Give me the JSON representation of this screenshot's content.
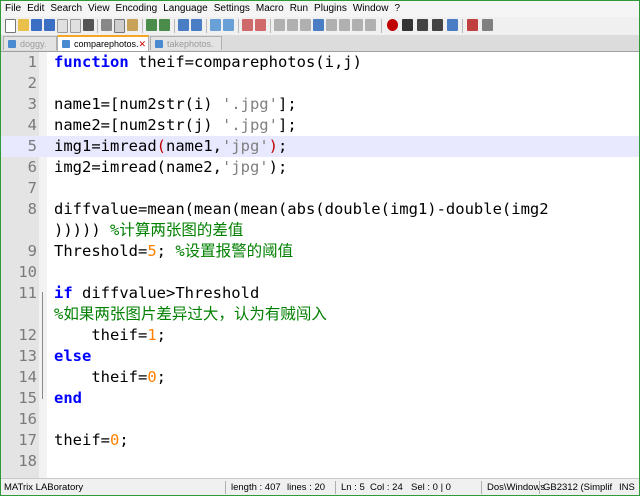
{
  "menu": [
    "File",
    "Edit",
    "Search",
    "View",
    "Encoding",
    "Language",
    "Settings",
    "Macro",
    "Run",
    "Plugins",
    "Window",
    "?"
  ],
  "tabs": [
    {
      "label": "doggy.",
      "active": false
    },
    {
      "label": "comparephotos.",
      "active": true
    },
    {
      "label": "takephotos.",
      "active": false
    }
  ],
  "editor": {
    "lines": [
      {
        "num": "1",
        "html": "<span class=\"kw\">function</span> theif=comparephotos(i,j)"
      },
      {
        "num": "2",
        "html": ""
      },
      {
        "num": "3",
        "html": "name1=[num2str(i) <span class=\"str\">'.jpg'</span>];"
      },
      {
        "num": "4",
        "html": "name2=[num2str(j) <span class=\"str\">'.jpg'</span>];"
      },
      {
        "num": "5",
        "html": "img1=imread<span style=\"color:#c00000\">(</span>name1,<span class=\"str\">'jpg'</span><span style=\"color:#c00000\">)</span>;"
      },
      {
        "num": "6",
        "html": "img2=imread(name2,<span class=\"str\">'jpg'</span>);"
      },
      {
        "num": "7",
        "html": ""
      },
      {
        "num": "8",
        "html": "diffvalue=mean(mean(mean(abs(double(img1)-double(img2"
      },
      {
        "num": "",
        "html": "))))) <span class=\"cmt\">%计算两张图的差值</span>"
      },
      {
        "num": "9",
        "html": "Threshold=<span class=\"num\">5</span>; <span class=\"cmt\">%设置报警的阈值</span>"
      },
      {
        "num": "10",
        "html": ""
      },
      {
        "num": "11",
        "html": "<span class=\"kw\">if</span> diffvalue>Threshold"
      },
      {
        "num": "",
        "html": "<span class=\"cmt\">%如果两张图片差异过大，认为有贼闯入</span>"
      },
      {
        "num": "12",
        "html": "    theif=<span class=\"num\">1</span>;"
      },
      {
        "num": "13",
        "html": "<span class=\"kw\">else</span>"
      },
      {
        "num": "14",
        "html": "    theif=<span class=\"num\">0</span>;"
      },
      {
        "num": "15",
        "html": "<span class=\"kw\">end</span>"
      },
      {
        "num": "16",
        "html": ""
      },
      {
        "num": "17",
        "html": "theif=<span class=\"num\">0</span>;"
      },
      {
        "num": "18",
        "html": ""
      }
    ]
  },
  "status": {
    "language": "MATrix LABoratory",
    "length": "length : 407",
    "lines": "lines : 20",
    "ln": "Ln : 5",
    "col": "Col : 24",
    "sel": "Sel : 0 | 0",
    "eol": "Dos\\Windows",
    "encoding": "GB2312 (Simplif",
    "ins": "INS"
  }
}
